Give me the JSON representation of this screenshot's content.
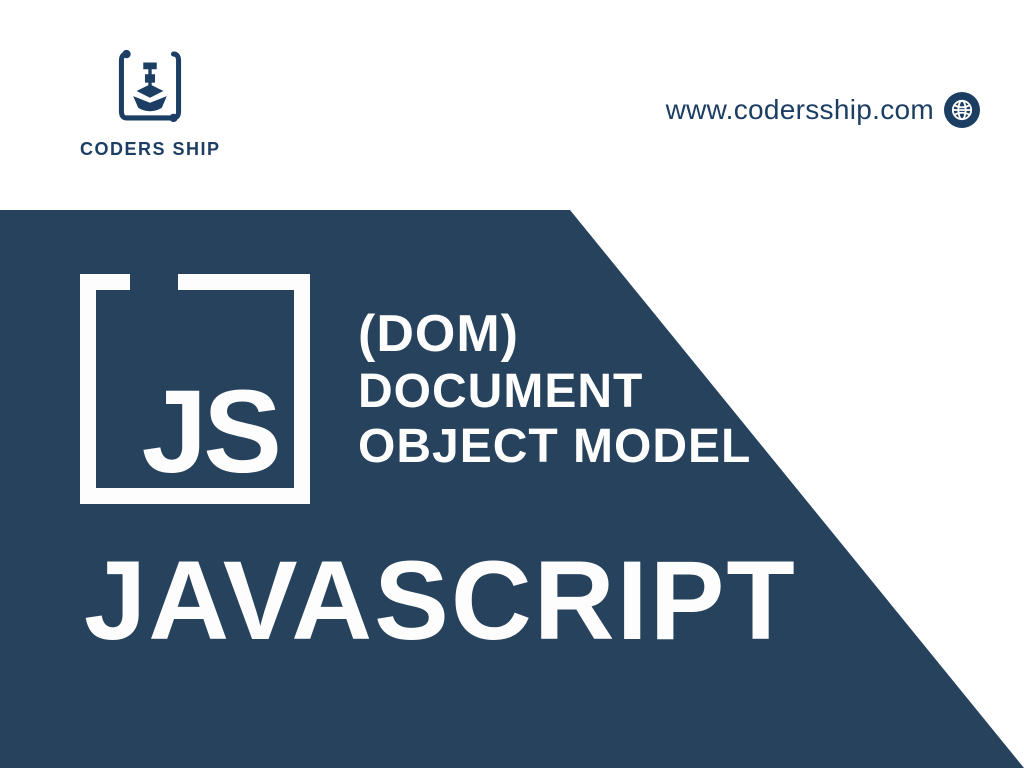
{
  "brand": {
    "name": "CODERS SHIP",
    "url": "www.codersship.com"
  },
  "badge": {
    "text": "JS"
  },
  "titles": {
    "dom": "(DOM)",
    "line1": "DOCUMENT",
    "line2": "OBJECT MODEL",
    "main": "JAVASCRIPT"
  },
  "colors": {
    "panel": "#26425c",
    "brand": "#1d3e63",
    "text": "#fdfdfd"
  }
}
